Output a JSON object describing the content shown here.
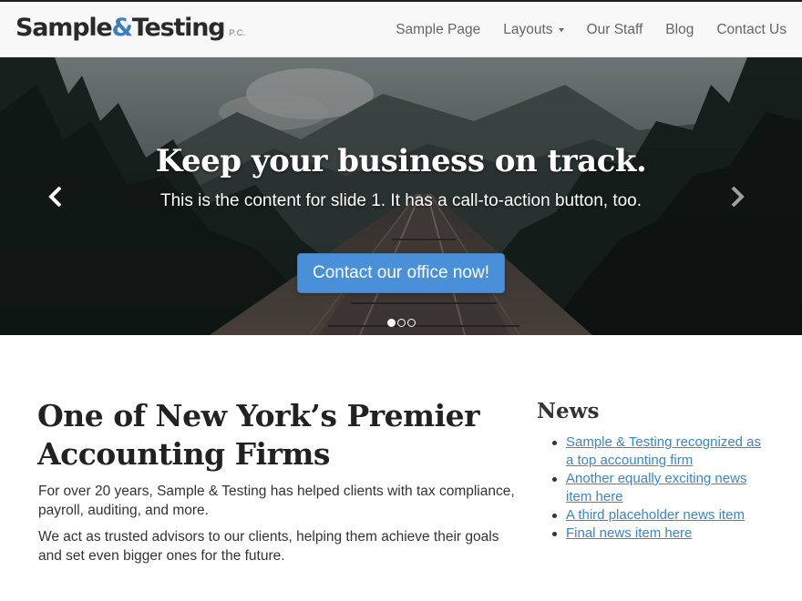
{
  "brand": {
    "name_part1": "Sample",
    "name_amp": "&",
    "name_part2": "Testing",
    "suffix": "P.C."
  },
  "nav": {
    "items": [
      {
        "label": "Sample Page"
      },
      {
        "label": "Layouts",
        "has_dropdown": true,
        "icon": "caret-down-icon"
      },
      {
        "label": "Our Staff"
      },
      {
        "label": "Blog"
      },
      {
        "label": "Contact Us"
      }
    ]
  },
  "hero": {
    "title": "Keep your business on track.",
    "text": "This is the content for slide 1. It has a call-to-action button, too.",
    "button_label": "Contact our office now!",
    "prev_icon": "chevron-left-icon",
    "next_icon": "chevron-right-icon",
    "slide_count": 3,
    "active_slide": 1,
    "button_color": "#4a90d9"
  },
  "main": {
    "title": "One of New York’s Premier Accounting Firms",
    "paragraphs": [
      "For over 20 years, Sample & Testing has helped clients with tax compliance, payroll, auditing, and more.",
      "We act as trusted advisors to our clients, helping them achieve their goals and set even bigger ones for the future."
    ]
  },
  "news": {
    "title": "News",
    "items": [
      "Sample & Testing recognized as a top accounting firm",
      "Another equally exciting news item here",
      "A third placeholder news item",
      "Final news item here"
    ],
    "link_color": "#3a86c6"
  }
}
